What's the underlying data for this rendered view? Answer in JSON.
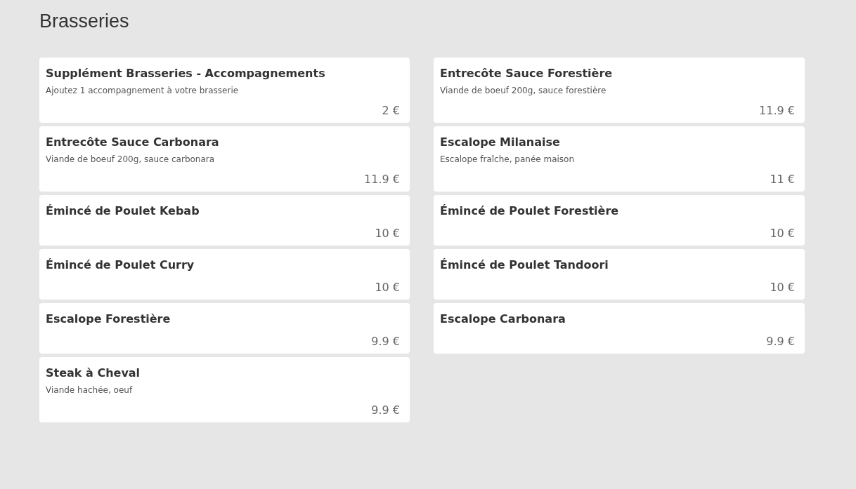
{
  "title": "Brasseries",
  "items": [
    {
      "name": "Supplément Brasseries - Accompagnements",
      "description": "Ajoutez 1 accompagnement à votre brasserie",
      "price": "2 €"
    },
    {
      "name": "Entrecôte Sauce Forestière",
      "description": "Viande de boeuf 200g, sauce forestière",
      "price": "11.9 €"
    },
    {
      "name": "Entrecôte Sauce Carbonara",
      "description": "Viande de boeuf 200g, sauce carbonara",
      "price": "11.9 €"
    },
    {
      "name": "Escalope Milanaise",
      "description": "Escalope fraîche, panée maison",
      "price": "11 €"
    },
    {
      "name": "Émincé de Poulet Kebab",
      "price": "10 €"
    },
    {
      "name": "Émincé de Poulet Forestière",
      "price": "10 €"
    },
    {
      "name": "Émincé de Poulet Curry",
      "price": "10 €"
    },
    {
      "name": "Émincé de Poulet Tandoori",
      "price": "10 €"
    },
    {
      "name": "Escalope Forestière",
      "price": "9.9 €"
    },
    {
      "name": "Escalope Carbonara",
      "price": "9.9 €"
    },
    {
      "name": "Steak à Cheval",
      "description": "Viande hachée, oeuf",
      "price": "9.9 €"
    }
  ]
}
